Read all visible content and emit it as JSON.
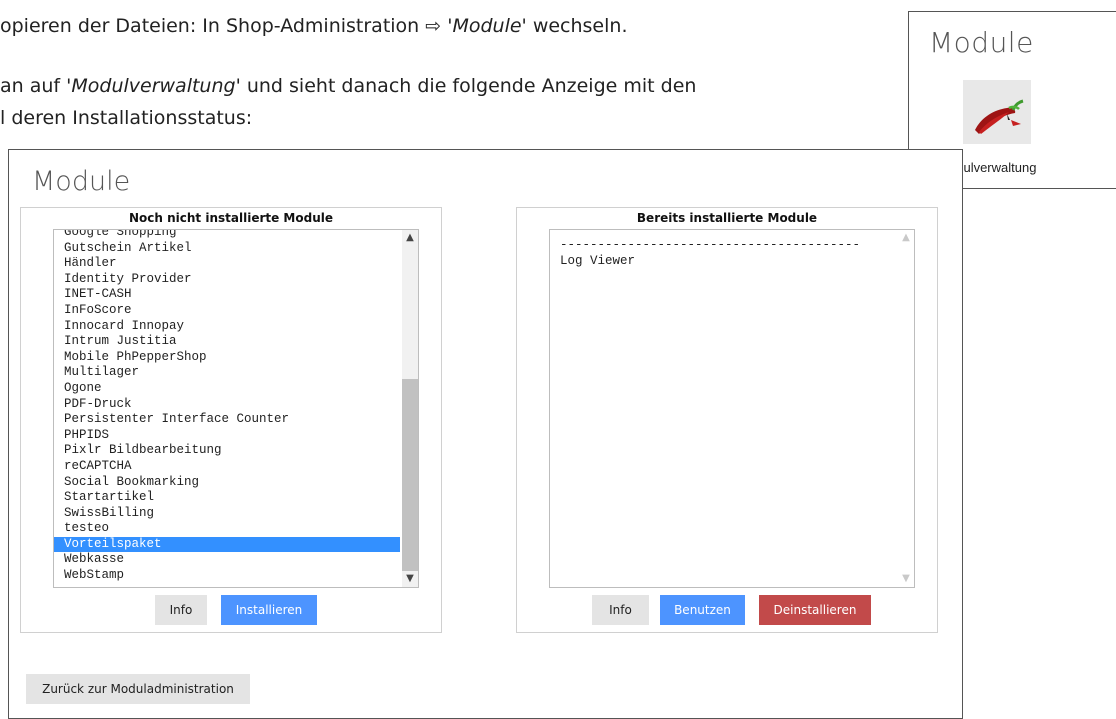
{
  "doc": {
    "line1_prefix": "opieren der Dateien: In Shop-Administration ⇨ ",
    "line1_italic": "'Module'",
    "line1_suffix": " wechseln.",
    "line2_prefix": "an auf '",
    "line2_italic": "Modulverwaltung'",
    "line2_suffix": " und sieht danach die folgende Anzeige mit den",
    "line3": "l deren Installationsstatus:"
  },
  "tile": {
    "title": "Module",
    "label": "odulverwaltung",
    "icon": "chili-pepper-icon"
  },
  "panel": {
    "title": "Module",
    "left": {
      "heading": "Noch nicht installierte Module",
      "items": [
        "Google Shopping",
        "Gutschein Artikel",
        "Händler",
        "Identity Provider",
        "INET-CASH",
        "InFoScore",
        "Innocard Innopay",
        "Intrum Justitia",
        "Mobile PhPepperShop",
        "Multilager",
        "Ogone",
        "PDF-Druck",
        "Persistenter Interface Counter",
        "PHPIDS",
        "Pixlr Bildbearbeitung",
        "reCAPTCHA",
        "Social Bookmarking",
        "Startartikel",
        "SwissBilling",
        "testeo",
        "Vorteilspaket",
        "Webkasse",
        "WebStamp"
      ],
      "selected": "Vorteilspaket",
      "info_label": "Info",
      "install_label": "Installieren"
    },
    "right": {
      "heading": "Bereits installierte Module",
      "items": [
        "----------------------------------------",
        "Log Viewer"
      ],
      "info_label": "Info",
      "use_label": "Benutzen",
      "uninstall_label": "Deinstallieren"
    },
    "back_label": "Zurück zur Moduladministration"
  },
  "colors": {
    "accent_blue": "#4d94ff",
    "danger_red": "#c24a4a",
    "selection_blue": "#3390ff"
  }
}
